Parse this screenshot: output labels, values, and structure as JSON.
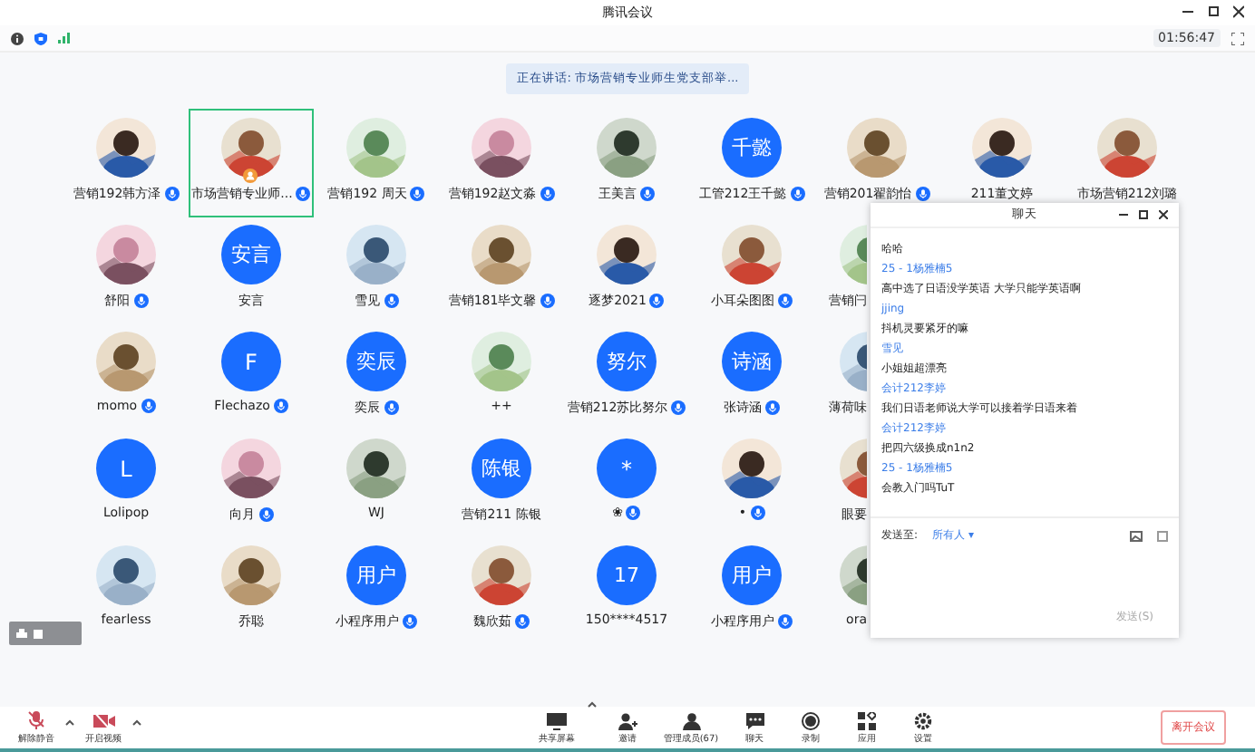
{
  "window": {
    "title": "腾讯会议"
  },
  "info_bar": {
    "timer": "01:56:47"
  },
  "speaking_banner": "正在讲话: 市场营销专业师生党支部举...",
  "grid_rows": [
    [
      {
        "name": "营销192韩方泽",
        "kind": "picture",
        "mic": true,
        "selected": false,
        "host": false
      },
      {
        "name": "市场营销专业师...",
        "kind": "picture",
        "mic": true,
        "selected": true,
        "host": true
      },
      {
        "name": "营销192 周天",
        "kind": "picture",
        "mic": true,
        "selected": false,
        "host": false
      },
      {
        "name": "营销192赵文淼",
        "kind": "picture",
        "mic": true,
        "selected": false,
        "host": false
      },
      {
        "name": "王美言",
        "kind": "picture",
        "mic": true,
        "selected": false,
        "host": false
      },
      {
        "name": "工管212王千懿",
        "kind": "text",
        "initials": "千懿",
        "mic": true,
        "selected": false,
        "host": false
      },
      {
        "name": "营销201翟韵怡",
        "kind": "picture",
        "mic": true,
        "selected": false,
        "host": false
      },
      {
        "name": "211董文婷",
        "kind": "picture",
        "mic": false,
        "selected": false,
        "host": false
      },
      {
        "name": "市场营销212刘璐",
        "kind": "picture",
        "mic": false,
        "selected": false,
        "host": false
      }
    ],
    [
      {
        "name": "舒阳",
        "kind": "picture",
        "mic": true,
        "selected": false,
        "host": false
      },
      {
        "name": "安言",
        "kind": "text",
        "initials": "安言",
        "mic": false,
        "selected": false,
        "host": false
      },
      {
        "name": "雪见",
        "kind": "picture",
        "mic": true,
        "selected": false,
        "host": false
      },
      {
        "name": "营销181毕文馨",
        "kind": "picture",
        "mic": true,
        "selected": false,
        "host": false
      },
      {
        "name": "逐梦2021",
        "kind": "picture",
        "mic": true,
        "selected": false,
        "host": false
      },
      {
        "name": "小耳朵图图",
        "kind": "picture",
        "mic": true,
        "selected": false,
        "host": false
      },
      {
        "name": "营销闩",
        "kind": "picture",
        "mic": false,
        "selected": false,
        "host": false,
        "cut": true
      }
    ],
    [
      {
        "name": "momo",
        "kind": "picture",
        "mic": true,
        "selected": false,
        "host": false
      },
      {
        "name": "Flechazo",
        "kind": "text",
        "initials": "F",
        "mic": true,
        "selected": false,
        "host": false
      },
      {
        "name": "奕辰",
        "kind": "text",
        "initials": "奕辰",
        "mic": true,
        "selected": false,
        "host": false
      },
      {
        "name": "++",
        "kind": "picture",
        "mic": false,
        "selected": false,
        "host": false
      },
      {
        "name": "营销212苏比努尔",
        "kind": "text",
        "initials": "努尔",
        "mic": true,
        "selected": false,
        "host": false
      },
      {
        "name": "张诗涵",
        "kind": "text",
        "initials": "诗涵",
        "mic": true,
        "selected": false,
        "host": false
      },
      {
        "name": "薄荷味",
        "kind": "picture",
        "mic": false,
        "selected": false,
        "host": false,
        "cut": true
      }
    ],
    [
      {
        "name": "Lolipop",
        "kind": "text",
        "initials": "L",
        "mic": false,
        "selected": false,
        "host": false
      },
      {
        "name": "向月",
        "kind": "picture",
        "mic": true,
        "selected": false,
        "host": false
      },
      {
        "name": "WJ",
        "kind": "picture",
        "mic": false,
        "selected": false,
        "host": false
      },
      {
        "name": "营销211 陈银",
        "kind": "text",
        "initials": "陈银",
        "mic": false,
        "selected": false,
        "host": false
      },
      {
        "name": "❀",
        "kind": "text",
        "initials": "*",
        "mic": true,
        "selected": false,
        "host": false
      },
      {
        "name": "•",
        "kind": "picture",
        "mic": true,
        "selected": false,
        "host": false
      },
      {
        "name": "眼要",
        "kind": "picture",
        "mic": false,
        "selected": false,
        "host": false,
        "cut": true
      }
    ],
    [
      {
        "name": "fearless",
        "kind": "picture",
        "mic": false,
        "selected": false,
        "host": false
      },
      {
        "name": "乔聪",
        "kind": "picture",
        "mic": false,
        "selected": false,
        "host": false
      },
      {
        "name": "小程序用户",
        "kind": "text",
        "initials": "用户",
        "mic": true,
        "selected": false,
        "host": false
      },
      {
        "name": "魏欣茹",
        "kind": "picture",
        "mic": true,
        "selected": false,
        "host": false
      },
      {
        "name": "150****4517",
        "kind": "text",
        "initials": "17",
        "mic": false,
        "selected": false,
        "host": false
      },
      {
        "name": "小程序用户",
        "kind": "text",
        "initials": "用户",
        "mic": true,
        "selected": false,
        "host": false
      },
      {
        "name": "ora",
        "kind": "picture",
        "mic": false,
        "selected": false,
        "host": false,
        "cut": true
      }
    ]
  ],
  "chat": {
    "title": "聊天",
    "messages": [
      {
        "kind": "text",
        "text": "哈哈"
      },
      {
        "kind": "sender",
        "text": "25 - 1杨雅楠5"
      },
      {
        "kind": "text",
        "text": "高中选了日语没学英语 大学只能学英语啊"
      },
      {
        "kind": "sender",
        "text": "jjing"
      },
      {
        "kind": "text",
        "text": "抖机灵要紧牙的嘛"
      },
      {
        "kind": "sender",
        "text": "雪见"
      },
      {
        "kind": "text",
        "text": "小姐姐超漂亮"
      },
      {
        "kind": "sender",
        "text": "会计212李婷"
      },
      {
        "kind": "text",
        "text": "我们日语老师说大学可以接着学日语来着"
      },
      {
        "kind": "sender",
        "text": "会计212李婷"
      },
      {
        "kind": "text",
        "text": "把四六级换成n1n2"
      },
      {
        "kind": "sender",
        "text": "25 - 1杨雅楠5"
      },
      {
        "kind": "text",
        "text": "会教入门吗TuT"
      }
    ],
    "send_to_label": "发送至:",
    "recipient": "所有人 ▾",
    "send_button": {
      "label": "发送(S)",
      "disabled": true
    }
  },
  "toolbar": {
    "left": [
      {
        "label": "解除静音",
        "kind": "mic"
      },
      {
        "label": "开启视频",
        "kind": "video"
      }
    ],
    "center": [
      {
        "label": "共享屏幕",
        "kind": "share"
      },
      {
        "label": "邀请",
        "kind": "invite"
      },
      {
        "label": "管理成员(67)",
        "kind": "members"
      },
      {
        "label": "聊天",
        "kind": "chat"
      },
      {
        "label": "录制",
        "kind": "record"
      },
      {
        "label": "应用",
        "kind": "apps"
      },
      {
        "label": "设置",
        "kind": "settings"
      }
    ],
    "leave_button": "离开会议"
  }
}
